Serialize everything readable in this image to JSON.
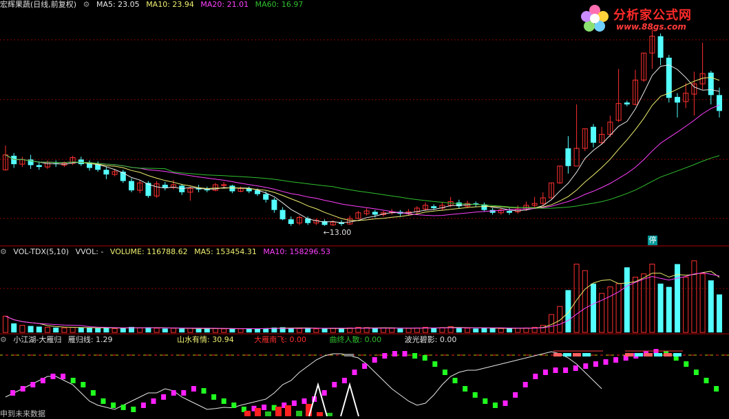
{
  "main_header": {
    "stock_title": "宏辉果蔬(日线,前复权)",
    "ma5": "MA5: 23.05",
    "ma10": "MA10: 23.94",
    "ma20": "MA20: 21.01",
    "ma60": "MA60: 16.97"
  },
  "vol_header": {
    "name": "VOL-TDX(5,10)",
    "vvol": "VVOL: -",
    "volume": "VOLUME: 116788.62",
    "ma5": "MA5: 153454.31",
    "ma10": "MA10: 158296.53"
  },
  "ind_header": {
    "name": "小江湖-大雁归",
    "l1": "雁归线: 1.29",
    "l2": "山水有情: 30.94",
    "l3": "大雁南飞: 0.00",
    "l4": "曲终人散: 0.00",
    "l5": "波光碧影: 0.00"
  },
  "annotations": {
    "low_label": "←13.00",
    "limit_label": "停"
  },
  "logo": {
    "text": "分析家公式网",
    "url": "www.88gs.com"
  },
  "footer": "申到未来数据",
  "colors": {
    "up": "#ff3030",
    "down": "#54ffff",
    "ma5": "#e8e8e8",
    "ma10": "#f0f070",
    "ma20": "#ff40ff",
    "ma60": "#30c030",
    "grid": "#8b0000"
  },
  "chart_data": [
    {
      "type": "candlestick",
      "title": "宏辉果蔬(日线,前复权)",
      "candles": [
        [
          19.0,
          20.6,
          21.6,
          18.9
        ],
        [
          20.5,
          19.6,
          20.8,
          19.2
        ],
        [
          19.6,
          20.1,
          20.4,
          19.3
        ],
        [
          20.1,
          19.5,
          20.6,
          19.1
        ],
        [
          19.5,
          19.3,
          19.9,
          19.0
        ],
        [
          19.3,
          19.8,
          20.0,
          19.1
        ],
        [
          19.7,
          19.6,
          20.0,
          19.3
        ],
        [
          19.5,
          19.7,
          19.9,
          19.3
        ],
        [
          19.7,
          20.3,
          20.5,
          19.5
        ],
        [
          20.1,
          19.6,
          20.4,
          19.4
        ],
        [
          19.8,
          19.2,
          20.0,
          18.9
        ],
        [
          19.6,
          19.0,
          19.9,
          18.8
        ],
        [
          19.0,
          18.5,
          19.3,
          18.0
        ],
        [
          18.5,
          18.8,
          19.1,
          18.3
        ],
        [
          18.8,
          17.8,
          19.0,
          17.6
        ],
        [
          17.8,
          16.8,
          18.1,
          16.6
        ],
        [
          16.8,
          17.6,
          17.9,
          16.5
        ],
        [
          17.6,
          16.2,
          17.8,
          16.0
        ],
        [
          16.2,
          17.5,
          17.8,
          16.0
        ],
        [
          17.4,
          17.1,
          17.7,
          16.8
        ],
        [
          17.1,
          17.4,
          17.9,
          16.9
        ],
        [
          17.3,
          16.6,
          17.5,
          16.3
        ],
        [
          16.6,
          17.0,
          17.2,
          15.7
        ],
        [
          17.0,
          16.9,
          17.4,
          16.6
        ],
        [
          16.9,
          16.8,
          17.2,
          16.6
        ],
        [
          16.8,
          17.4,
          17.6,
          16.7
        ],
        [
          17.4,
          17.4,
          17.7,
          17.0
        ],
        [
          17.3,
          16.7,
          17.4,
          16.5
        ],
        [
          16.7,
          17.0,
          17.2,
          16.6
        ],
        [
          17.0,
          16.7,
          17.2,
          16.5
        ],
        [
          16.8,
          16.4,
          17.0,
          16.2
        ],
        [
          16.4,
          15.8,
          16.7,
          15.5
        ],
        [
          15.8,
          14.7,
          16.0,
          14.4
        ],
        [
          14.7,
          13.7,
          15.0,
          13.6
        ],
        [
          13.7,
          13.2,
          14.0,
          13.0
        ],
        [
          13.3,
          13.9,
          14.1,
          13.1
        ],
        [
          13.8,
          13.3,
          14.0,
          13.1
        ],
        [
          13.3,
          13.6,
          13.8,
          13.1
        ],
        [
          13.5,
          13.1,
          13.7,
          13.0
        ],
        [
          13.1,
          13.4,
          13.6,
          13.0
        ],
        [
          13.4,
          13.2,
          13.6,
          13.0
        ],
        [
          13.2,
          13.8,
          14.1,
          13.1
        ],
        [
          13.8,
          14.4,
          14.6,
          13.7
        ],
        [
          14.3,
          14.6,
          14.9,
          14.1
        ],
        [
          14.5,
          14.2,
          14.7,
          13.9
        ],
        [
          14.2,
          14.4,
          14.6,
          14.0
        ],
        [
          14.4,
          14.5,
          14.8,
          14.2
        ],
        [
          14.5,
          14.3,
          14.7,
          14.0
        ],
        [
          14.3,
          14.5,
          14.8,
          14.1
        ],
        [
          14.5,
          14.9,
          15.1,
          14.3
        ],
        [
          14.8,
          15.2,
          15.5,
          14.6
        ],
        [
          15.1,
          14.9,
          15.3,
          14.7
        ],
        [
          14.9,
          15.2,
          15.5,
          14.7
        ],
        [
          15.2,
          15.6,
          16.1,
          15.0
        ],
        [
          15.5,
          15.1,
          15.8,
          14.9
        ],
        [
          15.1,
          15.4,
          15.7,
          14.9
        ],
        [
          15.4,
          15.3,
          15.6,
          15.0
        ],
        [
          15.3,
          14.7,
          15.5,
          14.5
        ],
        [
          14.7,
          14.4,
          14.9,
          14.2
        ],
        [
          14.4,
          14.7,
          14.9,
          14.2
        ],
        [
          14.6,
          14.4,
          14.9,
          14.2
        ],
        [
          14.5,
          14.8,
          15.2,
          14.3
        ],
        [
          14.8,
          15.2,
          15.6,
          14.6
        ],
        [
          15.2,
          15.4,
          16.1,
          15.0
        ],
        [
          15.4,
          16.0,
          16.6,
          15.1
        ],
        [
          16.0,
          17.6,
          17.6,
          15.9
        ],
        [
          17.6,
          19.4,
          19.4,
          17.5
        ],
        [
          21.3,
          19.4,
          22.6,
          18.6
        ],
        [
          19.4,
          21.3,
          26.0,
          21.2
        ],
        [
          21.3,
          23.4,
          23.4,
          21.0
        ],
        [
          23.6,
          21.9,
          23.9,
          21.4
        ],
        [
          21.9,
          22.8,
          23.6,
          21.7
        ],
        [
          22.8,
          24.1,
          24.8,
          22.5
        ],
        [
          24.3,
          26.1,
          29.8,
          24.1
        ],
        [
          26.2,
          26.0,
          26.4,
          25.8
        ],
        [
          26.0,
          28.6,
          29.7,
          25.9
        ],
        [
          28.6,
          31.5,
          31.5,
          28.4
        ],
        [
          31.5,
          33.3,
          34.3,
          29.8
        ],
        [
          33.3,
          31.0,
          33.6,
          30.2
        ],
        [
          31.0,
          26.7,
          31.3,
          26.2
        ],
        [
          26.8,
          26.2,
          27.2,
          24.6
        ],
        [
          26.3,
          27.2,
          28.3,
          25.6
        ],
        [
          27.1,
          28.2,
          29.5,
          24.8
        ],
        [
          28.2,
          29.3,
          32.6,
          27.6
        ],
        [
          29.4,
          27.0,
          29.6,
          26.0
        ],
        [
          27.0,
          25.3,
          27.8,
          24.6
        ]
      ],
      "low_marker": 13.0
    },
    {
      "type": "bar",
      "title": "VOL-TDX(5,10)",
      "volume": [
        50000,
        28000,
        22000,
        20000,
        18000,
        16000,
        15000,
        14000,
        16000,
        15000,
        14000,
        13000,
        15000,
        12000,
        14000,
        17000,
        14000,
        16000,
        13000,
        12000,
        13000,
        12000,
        13000,
        11000,
        12000,
        12000,
        11000,
        12000,
        11000,
        12000,
        11000,
        13000,
        15000,
        16000,
        14000,
        12000,
        13000,
        11000,
        12000,
        13000,
        12000,
        14000,
        16000,
        15000,
        13000,
        14000,
        13000,
        12000,
        13000,
        14000,
        16000,
        14000,
        15000,
        18000,
        14000,
        13000,
        12000,
        14000,
        13000,
        12000,
        12000,
        13000,
        14000,
        16000,
        22000,
        55000,
        80000,
        130000,
        210000,
        190000,
        150000,
        120000,
        140000,
        150000,
        200000,
        170000,
        180000,
        210000,
        150000,
        140000,
        210000,
        170000,
        220000,
        180000,
        160000,
        116788.62
      ]
    },
    {
      "type": "bar",
      "title": "小江湖-大雁归",
      "series": [
        {
          "name": "雁归线",
          "values": [
            0.4,
            0.5,
            0.6,
            0.7,
            0.8,
            0.9,
            0.9,
            0.8,
            0.7,
            0.5,
            0.3,
            0.2,
            0.15,
            0.1,
            0.2,
            0.3,
            0.4,
            0.5,
            0.5,
            0.6,
            0.55,
            0.4,
            0.3,
            0.2,
            0.1,
            0.12,
            0.15,
            0.14,
            0.2,
            0.25,
            0.3,
            0.35,
            0.5,
            0.7,
            0.8,
            1.0,
            1.15,
            1.3,
            1.4,
            1.45,
            1.45,
            1.4,
            1.35,
            1.2,
            1.0,
            0.8,
            0.6,
            0.45,
            0.3,
            0.2,
            0.25,
            0.45,
            0.7,
            0.9,
            1.0,
            1.05,
            1.05,
            1.1,
            1.15,
            1.2,
            1.25,
            1.3,
            1.35,
            1.4,
            1.45,
            1.5,
            1.45,
            1.35,
            1.2,
            1.0,
            0.8,
            0.6
          ]
        }
      ]
    }
  ]
}
